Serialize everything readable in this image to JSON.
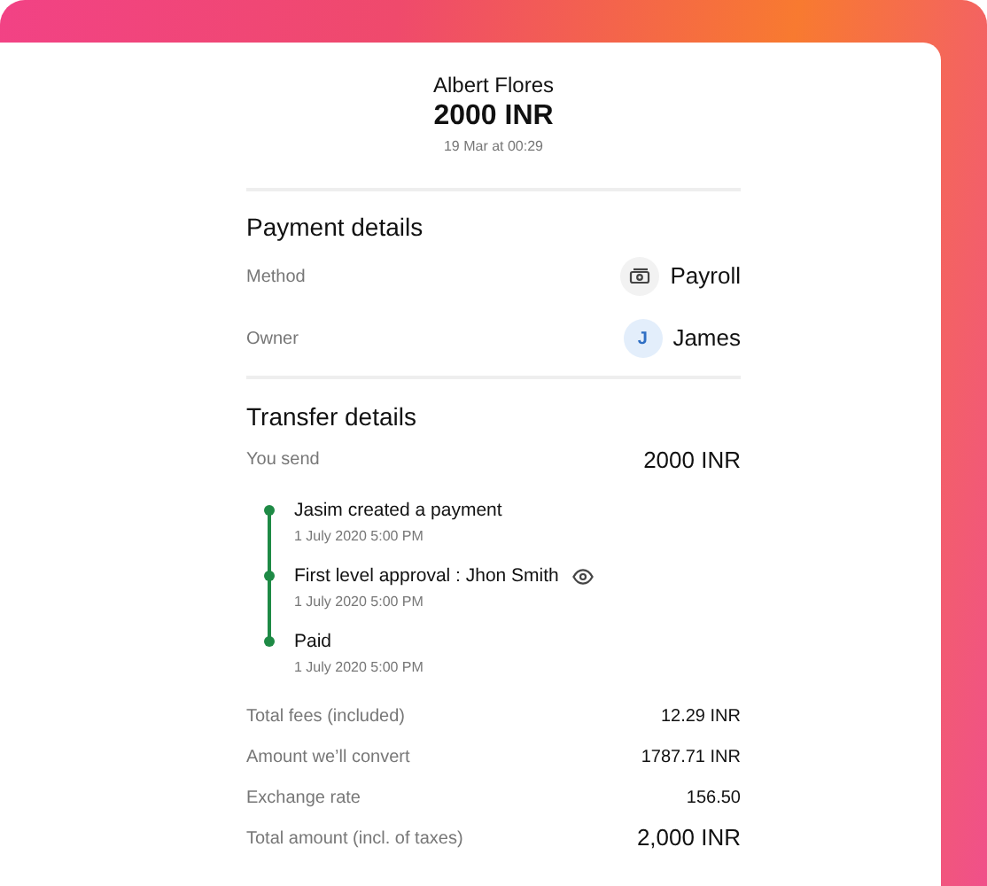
{
  "header": {
    "name": "Albert Flores",
    "amount": "2000 INR",
    "date": "19 Mar at 00:29"
  },
  "payment_details": {
    "title": "Payment details",
    "rows": [
      {
        "label": "Method",
        "value": "Payroll",
        "kind": "icon"
      },
      {
        "label": "Owner",
        "value": "James",
        "kind": "avatar",
        "initial": "J"
      }
    ]
  },
  "transfer_details": {
    "title": "Transfer details",
    "send_label": "You send",
    "send_value": "2000 INR",
    "timeline": [
      {
        "title": "Jasim created a payment",
        "time": "1 July 2020 5:00 PM",
        "viewable": false
      },
      {
        "title": "First level approval : Jhon Smith",
        "time": "1 July 2020 5:00 PM",
        "viewable": true
      },
      {
        "title": "Paid",
        "time": "1 July 2020 5:00 PM",
        "viewable": false
      }
    ],
    "summary": [
      {
        "label": "Total fees (included)",
        "value": "12.29 INR",
        "kind": "normal"
      },
      {
        "label": "Amount we’ll convert",
        "value": "1787.71 INR",
        "kind": "normal"
      },
      {
        "label": "Exchange rate",
        "value": "156.50",
        "kind": "normal"
      },
      {
        "label": "Total amount (incl. of taxes)",
        "value": "2,000 INR",
        "kind": "total"
      }
    ]
  }
}
